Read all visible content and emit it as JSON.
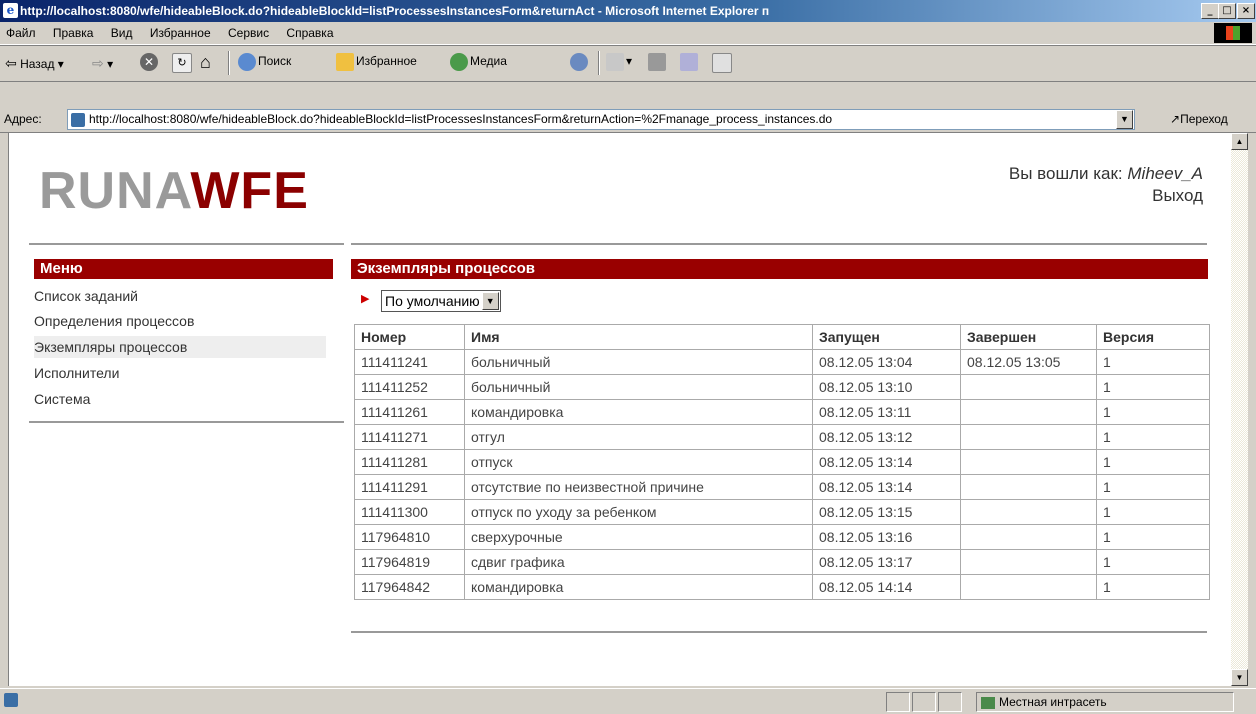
{
  "window": {
    "title": "http://localhost:8080/wfe/hideableBlock.do?hideableBlockId=listProcessesInstancesForm&returnAct - Microsoft Internet Explorer п",
    "controls": [
      "_",
      "□",
      "×"
    ]
  },
  "menu": [
    "Файл",
    "Правка",
    "Вид",
    "Избранное",
    "Сервис",
    "Справка"
  ],
  "toolbar": {
    "back": "Назад",
    "search": "Поиск",
    "favorites": "Избранное",
    "media": "Медиа"
  },
  "address": {
    "label": "Адрес:",
    "url": "http://localhost:8080/wfe/hideableBlock.do?hideableBlockId=listProcessesInstancesForm&returnAction=%2Fmanage_process_instances.do",
    "go": "Переход"
  },
  "page": {
    "logo_left": "RUNA",
    "logo_right": "WFE",
    "logged_in_label": "Вы вошли как:",
    "username": "Miheev_A",
    "logout": "Выход",
    "menu_title": "Меню",
    "menu_items": [
      "Список заданий",
      "Определения процессов",
      "Экземпляры процессов",
      "Исполнители",
      "Система"
    ],
    "active_menu_index": 2,
    "section_title": "Экземпляры процессов",
    "filter_value": "По умолчанию",
    "columns": [
      "Номер",
      "Имя",
      "Запущен",
      "Завершен",
      "Версия"
    ],
    "rows": [
      [
        "111411241",
        "больничный",
        "08.12.05 13:04",
        "08.12.05 13:05",
        "1"
      ],
      [
        "111411252",
        "больничный",
        "08.12.05 13:10",
        "",
        "1"
      ],
      [
        "111411261",
        "командировка",
        "08.12.05 13:11",
        "",
        "1"
      ],
      [
        "111411271",
        "отгул",
        "08.12.05 13:12",
        "",
        "1"
      ],
      [
        "111411281",
        "отпуск",
        "08.12.05 13:14",
        "",
        "1"
      ],
      [
        "111411291",
        "отсутствие по неизвестной причине",
        "08.12.05 13:14",
        "",
        "1"
      ],
      [
        "111411300",
        "отпуск по уходу за ребенком",
        "08.12.05 13:15",
        "",
        "1"
      ],
      [
        "117964810",
        "сверхурочные",
        "08.12.05 13:16",
        "",
        "1"
      ],
      [
        "117964819",
        "сдвиг графика",
        "08.12.05 13:17",
        "",
        "1"
      ],
      [
        "117964842",
        "командировка",
        "08.12.05 14:14",
        "",
        "1"
      ]
    ]
  },
  "status": {
    "zone": "Местная интрасеть"
  },
  "colors": {
    "accent": "#990000",
    "titlebar": "#0a246a"
  }
}
